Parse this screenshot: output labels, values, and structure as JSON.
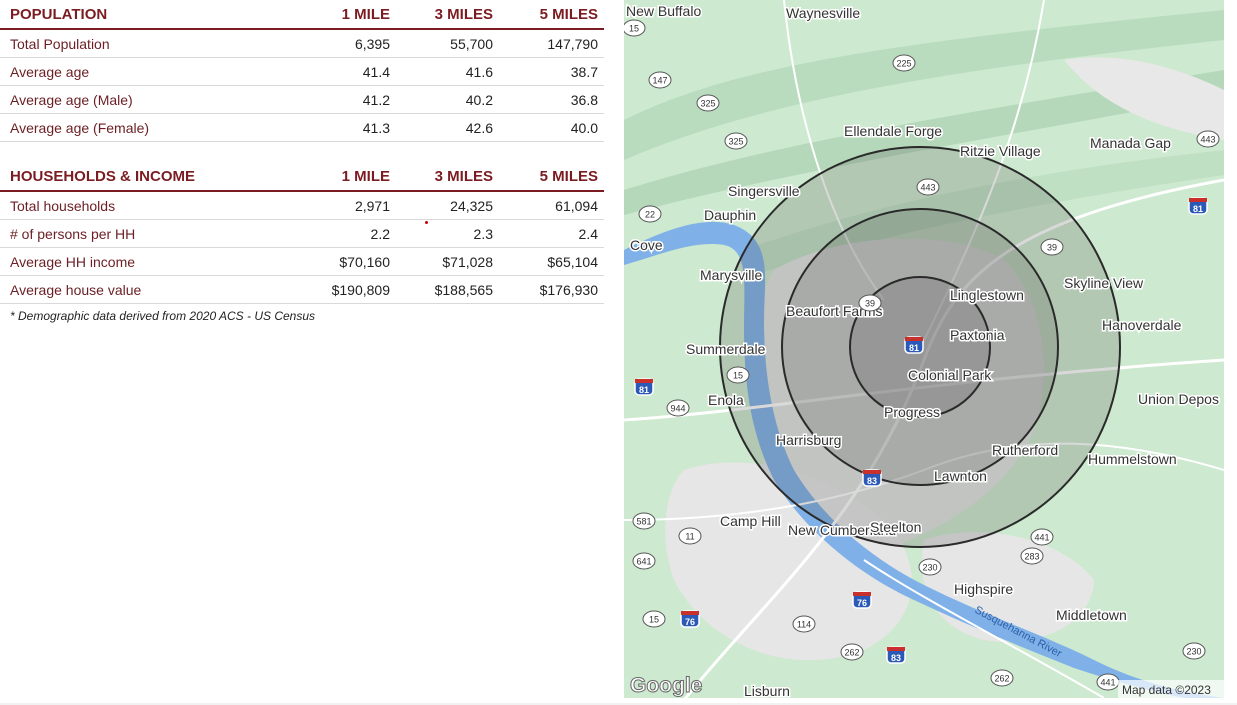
{
  "population": {
    "title": "POPULATION",
    "columns": [
      "1 MILE",
      "3 MILES",
      "5 MILES"
    ],
    "rows": [
      {
        "label": "Total Population",
        "values": [
          "6,395",
          "55,700",
          "147,790"
        ]
      },
      {
        "label": "Average age",
        "values": [
          "41.4",
          "41.6",
          "38.7"
        ]
      },
      {
        "label": "Average age (Male)",
        "values": [
          "41.2",
          "40.2",
          "36.8"
        ]
      },
      {
        "label": "Average age (Female)",
        "values": [
          "41.3",
          "42.6",
          "40.0"
        ]
      }
    ]
  },
  "households": {
    "title": "HOUSEHOLDS & INCOME",
    "columns": [
      "1 MILE",
      "3 MILES",
      "5 MILES"
    ],
    "rows": [
      {
        "label": "Total households",
        "values": [
          "2,971",
          "24,325",
          "61,094"
        ]
      },
      {
        "label": "# of persons per HH",
        "values": [
          "2.2",
          "2.3",
          "2.4"
        ]
      },
      {
        "label": "Average HH income",
        "values": [
          "$70,160",
          "$71,028",
          "$65,104"
        ]
      },
      {
        "label": "Average house value",
        "values": [
          "$190,809",
          "$188,565",
          "$176,930"
        ]
      }
    ]
  },
  "footnote": "* Demographic data derived from 2020 ACS - US Census",
  "map": {
    "places": [
      "New Buffalo",
      "Waynesville",
      "Ellendale Forge",
      "Ritzie Village",
      "Manada Gap",
      "Singersville",
      "Dauphin",
      "Cove",
      "Marysville",
      "Skyline View",
      "Linglestown",
      "Beaufort Farms",
      "Paxtonia",
      "Hanoverdale",
      "Summerdale",
      "Colonial Park",
      "Enola",
      "Union Depos",
      "Progress",
      "Harrisburg",
      "Rutherford",
      "Hummelstown",
      "Lawnton",
      "Camp Hill",
      "New Cumberland",
      "Steelton",
      "Highspire",
      "Middletown",
      "Lisburn"
    ],
    "river_label": "Susquehanna River",
    "route_shields": [
      "15",
      "147",
      "325",
      "225",
      "325",
      "443",
      "443",
      "22",
      "39",
      "39",
      "15",
      "944",
      "581",
      "11",
      "641",
      "441",
      "283",
      "230",
      "15",
      "114",
      "262",
      "262",
      "230",
      "441"
    ],
    "interstate_shields": [
      "81",
      "81",
      "81",
      "83",
      "76",
      "76",
      "83"
    ],
    "logo": "Google",
    "attribution": "Map data ©2023",
    "colors": {
      "land": "#cde9cf",
      "urban": "#e6e6e6",
      "water": "#7fb1e8",
      "ring_fill": "#505050",
      "ring_stroke": "#2a2a2a"
    }
  }
}
